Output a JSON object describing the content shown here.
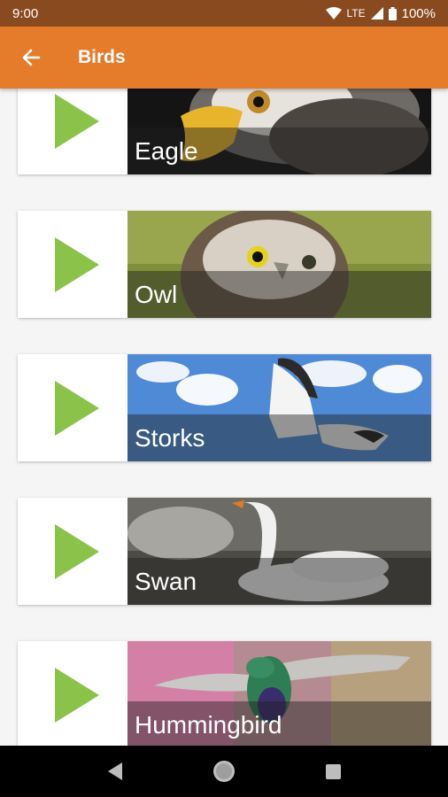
{
  "status_bar": {
    "time": "9:00",
    "network": "LTE",
    "battery": "100%"
  },
  "app_bar": {
    "title": "Birds"
  },
  "birds": [
    {
      "name": "Eagle"
    },
    {
      "name": "Owl"
    },
    {
      "name": "Storks"
    },
    {
      "name": "Swan"
    },
    {
      "name": "Hummingbird"
    }
  ],
  "colors": {
    "status": "#8a4a1f",
    "app_bar": "#e47c2c",
    "play": "#8bc34a"
  },
  "icons": [
    "back-arrow-icon",
    "play-icon",
    "wifi-icon",
    "signal-icon",
    "battery-icon",
    "nav-back-icon",
    "nav-home-icon",
    "nav-recents-icon"
  ]
}
